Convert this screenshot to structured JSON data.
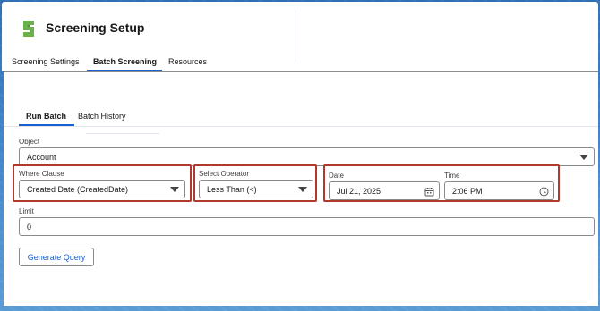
{
  "app": {
    "title": "Screening Setup",
    "accent": "#1b5fcf",
    "highlight": "#b0392b",
    "logo_color": "#6ab04c"
  },
  "top_tabs": [
    {
      "label": "Screening Settings",
      "active": false
    },
    {
      "label": "Batch Screening",
      "active": true
    },
    {
      "label": "Resources",
      "active": false
    }
  ],
  "sub_tabs": [
    {
      "label": "Run Batch",
      "active": true
    },
    {
      "label": "Batch History",
      "active": false
    }
  ],
  "form": {
    "object": {
      "label": "Object",
      "value": "Account"
    },
    "where_clause": {
      "label": "Where Clause",
      "value": "Created Date (CreatedDate)"
    },
    "operator": {
      "label": "Select Operator",
      "value": "Less Than (<)"
    },
    "date": {
      "label": "Date",
      "value": "Jul 21, 2025",
      "icon": "calendar-icon"
    },
    "time": {
      "label": "Time",
      "value": "2:06 PM",
      "icon": "clock-icon"
    },
    "limit": {
      "label": "Limit",
      "value": "0"
    },
    "generate_button": "Generate Query"
  }
}
